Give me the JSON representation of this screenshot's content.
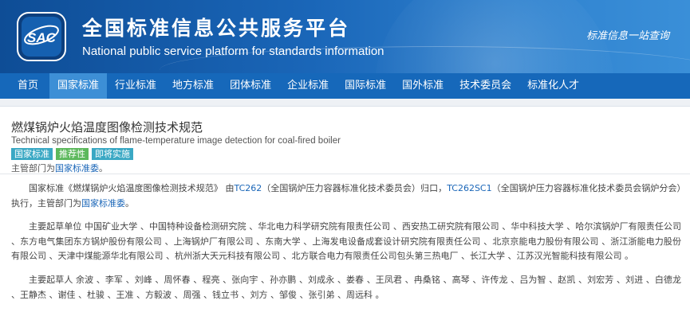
{
  "header": {
    "logo_text": "SAC",
    "title_cn": "全国标准信息公共服务平台",
    "title_en": "National public service platform  for standards information",
    "slogan": "标准信息一站查询"
  },
  "nav": {
    "items": [
      {
        "label": "首页",
        "active": false
      },
      {
        "label": "国家标准",
        "active": true
      },
      {
        "label": "行业标准",
        "active": false
      },
      {
        "label": "地方标准",
        "active": false
      },
      {
        "label": "团体标准",
        "active": false
      },
      {
        "label": "企业标准",
        "active": false
      },
      {
        "label": "国际标准",
        "active": false
      },
      {
        "label": "国外标准",
        "active": false
      },
      {
        "label": "技术委员会",
        "active": false
      },
      {
        "label": "标准化人才",
        "active": false
      }
    ]
  },
  "standard": {
    "title_cn": "燃煤锅炉火焰温度图像检测技术规范",
    "title_en": "Technical specifications of flame-temperature image detection for coal-fired boiler",
    "badges": [
      "国家标准",
      "推荐性",
      "即将实施"
    ],
    "dept_prefix": "主管部门为",
    "dept_link": "国家标准委",
    "dept_suffix": "。"
  },
  "body": {
    "p1_prefix": "国家标准《燃煤锅炉火焰温度图像检测技术规范》 由",
    "p1_tc1": "TC262",
    "p1_mid": "（全国锅炉压力容器标准化技术委员会）归口，",
    "p1_tc2": "TC262SC1",
    "p1_suffix": "（全国锅炉压力容器标准化技术委员会锅炉分会）执行，主管部门为",
    "p1_dept": "国家标准委",
    "p1_end": "。",
    "p2": "主要起草单位 中国矿业大学 、中国特种设备检测研究院 、华北电力科学研究院有限责任公司 、西安热工研究院有限公司 、华中科技大学 、哈尔滨锅炉厂有限责任公司 、东方电气集团东方锅炉股份有限公司 、上海锅炉厂有限公司 、东南大学 、上海发电设备成套设计研究院有限责任公司 、北京京能电力股份有限公司 、浙江浙能电力股份有限公司 、天津中煤能源华北有限公司 、杭州浙大天元科技有限公司 、北方联合电力有限责任公司包头第三热电厂 、长江大学 、江苏汉光智能科技有限公司 。",
    "p3": "主要起草人 余波 、李军 、刘峰 、周怀春 、程亮 、张向宇 、孙亦鹏 、刘成永 、娄春 、王凤君 、冉桑铭 、高琴 、许传龙 、吕为智 、赵凯 、刘宏芳 、刘进 、白德龙 、王静杰 、谢佳 、杜骏 、王准 、方毅波 、周强 、钱立书 、刘方 、邹俊 、张引弟 、周远科 。"
  },
  "colors": {
    "header_blue": "#1a66b8",
    "nav_blue": "#1668ba",
    "nav_active": "#3d8fd6",
    "link": "#1a66b8",
    "badge_teal": "#3aa8c4",
    "badge_green": "#5cb85c"
  }
}
